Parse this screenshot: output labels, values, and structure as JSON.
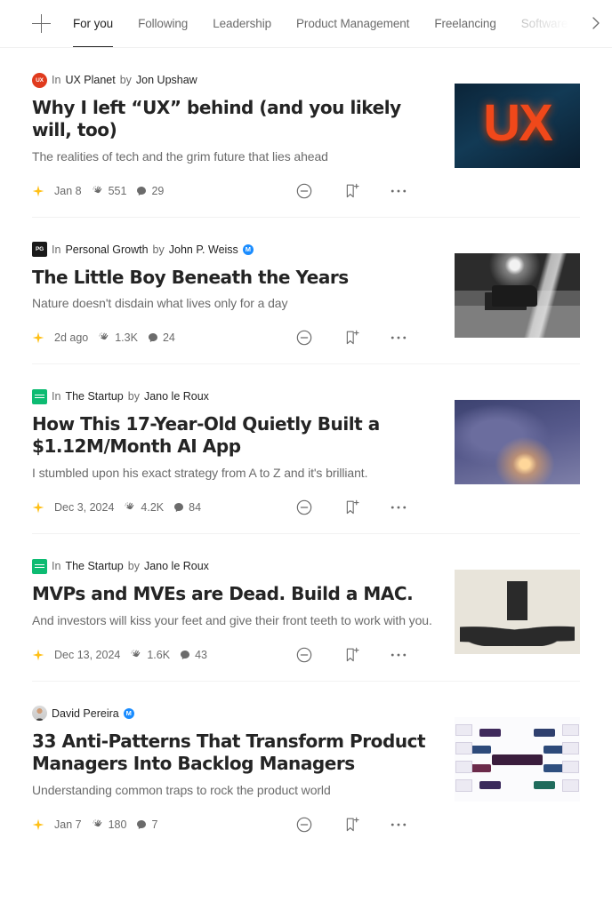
{
  "topbar": {
    "add_label": "+",
    "next_icon": "chevron-right-icon",
    "tabs": [
      {
        "label": "For you",
        "active": true,
        "faded": false
      },
      {
        "label": "Following",
        "active": false,
        "faded": false
      },
      {
        "label": "Leadership",
        "active": false,
        "faded": false
      },
      {
        "label": "Product Management",
        "active": false,
        "faded": false
      },
      {
        "label": "Freelancing",
        "active": false,
        "faded": false
      },
      {
        "label": "Software E",
        "active": false,
        "faded": true
      }
    ]
  },
  "colors": {
    "text": "#242424",
    "muted": "#6b6b6b",
    "star": "#ffc017",
    "verified_badge": "#1a8cff",
    "ux_planet_avatar": "#e03b1e",
    "personal_growth_avatar": "#1a1a1a",
    "the_startup_avatar": "#0dbb72"
  },
  "labels": {
    "in": "In",
    "by": "by",
    "member_badge": "M"
  },
  "actions": {
    "hide": "hide-story-icon",
    "save": "save-bookmark-icon",
    "more": "more-options-icon"
  },
  "articles": [
    {
      "avatar_kind": "ux",
      "avatar_text": "UX",
      "publication": "UX Planet",
      "author": "Jon Upshaw",
      "verified": false,
      "has_publication": true,
      "title": "Why I left “UX” behind (and you likely will, too)",
      "subtitle": "The realities of tech and the grim future that lies ahead",
      "member_only": true,
      "date": "Jan 8",
      "claps": "551",
      "comments": "29",
      "thumb_class": "t1",
      "thumb_alt": "Orange UX letters on dark blue water background"
    },
    {
      "avatar_kind": "pg",
      "avatar_text": "PG",
      "publication": "Personal Growth",
      "author": "John P. Weiss",
      "verified": true,
      "has_publication": true,
      "title": "The Little Boy Beneath the Years",
      "subtitle": "Nature doesn't disdain what lives only for a day",
      "member_only": true,
      "date": "2d ago",
      "claps": "1.3K",
      "comments": "24",
      "thumb_class": "t2",
      "thumb_alt": "Black and white photo of an old steam locomotive"
    },
    {
      "avatar_kind": "ts",
      "avatar_text": "",
      "publication": "The Startup",
      "author": "Jano le Roux",
      "verified": false,
      "has_publication": true,
      "title": "How This 17-Year-Old Quietly Built a $1.12M/Month AI App",
      "subtitle": "I stumbled upon his exact strategy from A to Z and it's brilliant.",
      "member_only": true,
      "date": "Dec 3, 2024",
      "claps": "4.2K",
      "comments": "84",
      "thumb_class": "t3",
      "thumb_alt": "Purple illustration of a boy with a glowing light"
    },
    {
      "avatar_kind": "ts",
      "avatar_text": "",
      "publication": "The Startup",
      "author": "Jano le Roux",
      "verified": false,
      "has_publication": true,
      "title": "MVPs and MVEs are Dead. Build a MAC.",
      "subtitle": "And investors will kiss your feet and give their front teeth to work with you.",
      "member_only": true,
      "date": "Dec 13, 2024",
      "claps": "1.6K",
      "comments": "43",
      "thumb_class": "t4",
      "thumb_alt": "Retro illustration of businessmen bowing to a seated figure"
    },
    {
      "avatar_kind": "photo",
      "avatar_text": "",
      "publication": "",
      "author": "David Pereira",
      "verified": true,
      "has_publication": false,
      "title": "33 Anti-Patterns That Transform Product Managers Into Backlog Managers",
      "subtitle": "Understanding common traps to rock the product world",
      "member_only": true,
      "date": "Jan 7",
      "claps": "180",
      "comments": "7",
      "thumb_class": "t5",
      "thumb_alt": "Mind map diagram with purple nodes radiating from a center node"
    }
  ]
}
